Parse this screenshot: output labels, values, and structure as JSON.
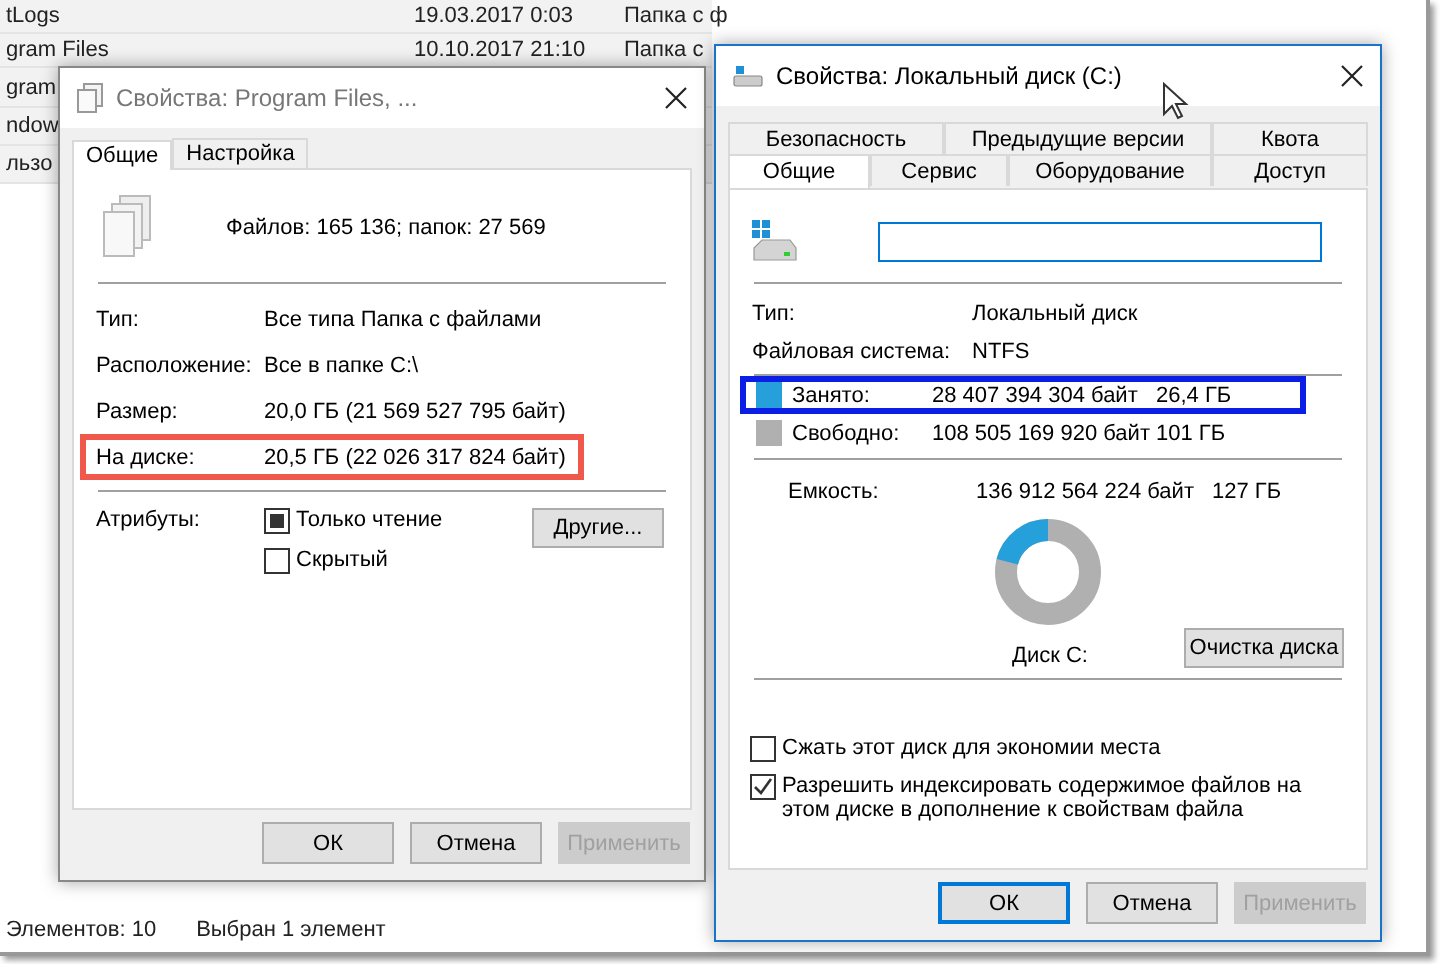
{
  "explorer": {
    "rows": [
      {
        "name": "tLogs",
        "date": "19.03.2017 0:03",
        "type": "Папка с ф"
      },
      {
        "name": "gram Files",
        "date": "10.10.2017 21:10",
        "type": "Папка с"
      },
      {
        "name": "gram"
      },
      {
        "name": "ndow"
      },
      {
        "name": "льзо"
      }
    ],
    "status_bar": [
      "Элементов: 10",
      "Выбран 1 элемент"
    ]
  },
  "folder_dialog": {
    "title": "Свойства: Program Files, ...",
    "tabs": [
      {
        "label": "Общие",
        "selected": true
      },
      {
        "label": "Настройка",
        "selected": false
      }
    ],
    "summary": "Файлов: 165 136; папок: 27 569",
    "properties": [
      {
        "label": "Тип:",
        "value": "Все типа Папка с файлами",
        "highlighted": false
      },
      {
        "label": "Расположение:",
        "value": "Все в папке C:\\",
        "highlighted": false
      },
      {
        "label": "Размер:",
        "value": "20,0 ГБ (21 569 527 795 байт)",
        "highlighted": false
      },
      {
        "label": "На диске:",
        "value": "20,5 ГБ (22 026 317 824 байт)",
        "highlighted": true
      }
    ],
    "attributes_label": "Атрибуты:",
    "attributes": [
      {
        "label": "Только чтение",
        "checked": false,
        "indeterminate": true
      },
      {
        "label": "Скрытый",
        "checked": false,
        "indeterminate": false
      }
    ],
    "other_button": "Другие...",
    "buttons": [
      {
        "label": "ОК",
        "default": false,
        "disabled": false
      },
      {
        "label": "Отмена",
        "default": false,
        "disabled": false
      },
      {
        "label": "Применить",
        "default": false,
        "disabled": true
      }
    ]
  },
  "drive_dialog": {
    "title": "Свойства: Локальный диск (C:)",
    "tabs_back": [
      {
        "label": "Безопасность",
        "selected": false
      },
      {
        "label": "Предыдущие версии",
        "selected": false
      },
      {
        "label": "Квота",
        "selected": false
      }
    ],
    "tabs_front": [
      {
        "label": "Общие",
        "selected": true
      },
      {
        "label": "Сервис",
        "selected": false
      },
      {
        "label": "Оборудование",
        "selected": false
      },
      {
        "label": "Доступ",
        "selected": false
      }
    ],
    "properties": [
      {
        "label": "Тип:",
        "value": "Локальный диск"
      },
      {
        "label": "Файловая система:",
        "value": "NTFS"
      }
    ],
    "usage": [
      {
        "label": "Занято:",
        "bytes": "28 407 394 304 байт",
        "size": "26,4 ГБ",
        "color": "#26a0da",
        "highlighted": true
      },
      {
        "label": "Свободно:",
        "bytes": "108 505 169 920 байт",
        "size": "101 ГБ",
        "color": "#b0b0b0",
        "highlighted": false
      }
    ],
    "capacity": {
      "label": "Емкость:",
      "bytes": "136 912 564 224 байт",
      "size": "127 ГБ"
    },
    "ring": {
      "level": 0.21
    },
    "drive_label": "Диск C:",
    "cleanup_button": "Очистка диска",
    "options": [
      {
        "label": "Сжать этот диск для экономии места",
        "checked": false
      },
      {
        "label": "Разрешить индексировать содержимое файлов на этом диске в дополнение к свойствам файла",
        "checked": true
      }
    ],
    "buttons": [
      {
        "label": "ОК",
        "default": true,
        "disabled": false
      },
      {
        "label": "Отмена",
        "default": false,
        "disabled": false
      },
      {
        "label": "Применить",
        "default": false,
        "disabled": true
      }
    ]
  }
}
